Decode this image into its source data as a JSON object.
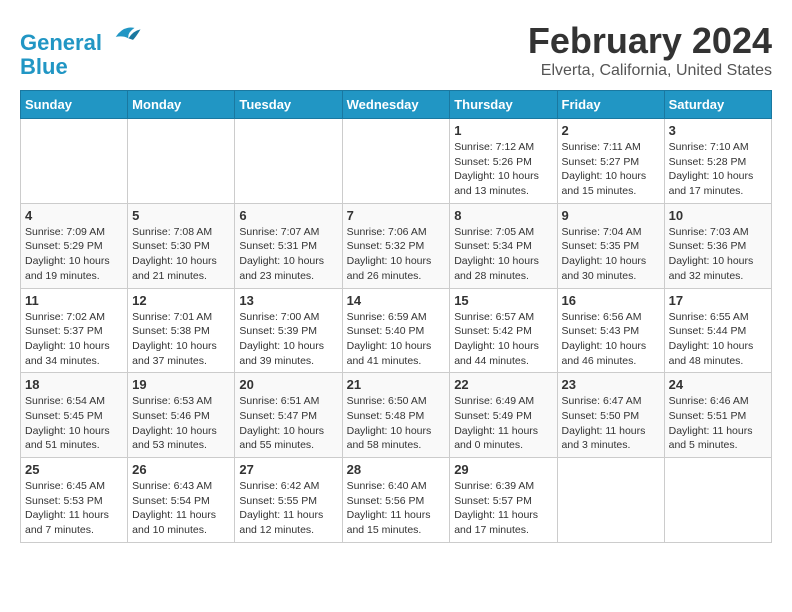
{
  "logo": {
    "line1": "General",
    "line2": "Blue"
  },
  "title": "February 2024",
  "location": "Elverta, California, United States",
  "days_header": [
    "Sunday",
    "Monday",
    "Tuesday",
    "Wednesday",
    "Thursday",
    "Friday",
    "Saturday"
  ],
  "weeks": [
    [
      {
        "day": "",
        "info": ""
      },
      {
        "day": "",
        "info": ""
      },
      {
        "day": "",
        "info": ""
      },
      {
        "day": "",
        "info": ""
      },
      {
        "day": "1",
        "info": "Sunrise: 7:12 AM\nSunset: 5:26 PM\nDaylight: 10 hours\nand 13 minutes."
      },
      {
        "day": "2",
        "info": "Sunrise: 7:11 AM\nSunset: 5:27 PM\nDaylight: 10 hours\nand 15 minutes."
      },
      {
        "day": "3",
        "info": "Sunrise: 7:10 AM\nSunset: 5:28 PM\nDaylight: 10 hours\nand 17 minutes."
      }
    ],
    [
      {
        "day": "4",
        "info": "Sunrise: 7:09 AM\nSunset: 5:29 PM\nDaylight: 10 hours\nand 19 minutes."
      },
      {
        "day": "5",
        "info": "Sunrise: 7:08 AM\nSunset: 5:30 PM\nDaylight: 10 hours\nand 21 minutes."
      },
      {
        "day": "6",
        "info": "Sunrise: 7:07 AM\nSunset: 5:31 PM\nDaylight: 10 hours\nand 23 minutes."
      },
      {
        "day": "7",
        "info": "Sunrise: 7:06 AM\nSunset: 5:32 PM\nDaylight: 10 hours\nand 26 minutes."
      },
      {
        "day": "8",
        "info": "Sunrise: 7:05 AM\nSunset: 5:34 PM\nDaylight: 10 hours\nand 28 minutes."
      },
      {
        "day": "9",
        "info": "Sunrise: 7:04 AM\nSunset: 5:35 PM\nDaylight: 10 hours\nand 30 minutes."
      },
      {
        "day": "10",
        "info": "Sunrise: 7:03 AM\nSunset: 5:36 PM\nDaylight: 10 hours\nand 32 minutes."
      }
    ],
    [
      {
        "day": "11",
        "info": "Sunrise: 7:02 AM\nSunset: 5:37 PM\nDaylight: 10 hours\nand 34 minutes."
      },
      {
        "day": "12",
        "info": "Sunrise: 7:01 AM\nSunset: 5:38 PM\nDaylight: 10 hours\nand 37 minutes."
      },
      {
        "day": "13",
        "info": "Sunrise: 7:00 AM\nSunset: 5:39 PM\nDaylight: 10 hours\nand 39 minutes."
      },
      {
        "day": "14",
        "info": "Sunrise: 6:59 AM\nSunset: 5:40 PM\nDaylight: 10 hours\nand 41 minutes."
      },
      {
        "day": "15",
        "info": "Sunrise: 6:57 AM\nSunset: 5:42 PM\nDaylight: 10 hours\nand 44 minutes."
      },
      {
        "day": "16",
        "info": "Sunrise: 6:56 AM\nSunset: 5:43 PM\nDaylight: 10 hours\nand 46 minutes."
      },
      {
        "day": "17",
        "info": "Sunrise: 6:55 AM\nSunset: 5:44 PM\nDaylight: 10 hours\nand 48 minutes."
      }
    ],
    [
      {
        "day": "18",
        "info": "Sunrise: 6:54 AM\nSunset: 5:45 PM\nDaylight: 10 hours\nand 51 minutes."
      },
      {
        "day": "19",
        "info": "Sunrise: 6:53 AM\nSunset: 5:46 PM\nDaylight: 10 hours\nand 53 minutes."
      },
      {
        "day": "20",
        "info": "Sunrise: 6:51 AM\nSunset: 5:47 PM\nDaylight: 10 hours\nand 55 minutes."
      },
      {
        "day": "21",
        "info": "Sunrise: 6:50 AM\nSunset: 5:48 PM\nDaylight: 10 hours\nand 58 minutes."
      },
      {
        "day": "22",
        "info": "Sunrise: 6:49 AM\nSunset: 5:49 PM\nDaylight: 11 hours\nand 0 minutes."
      },
      {
        "day": "23",
        "info": "Sunrise: 6:47 AM\nSunset: 5:50 PM\nDaylight: 11 hours\nand 3 minutes."
      },
      {
        "day": "24",
        "info": "Sunrise: 6:46 AM\nSunset: 5:51 PM\nDaylight: 11 hours\nand 5 minutes."
      }
    ],
    [
      {
        "day": "25",
        "info": "Sunrise: 6:45 AM\nSunset: 5:53 PM\nDaylight: 11 hours\nand 7 minutes."
      },
      {
        "day": "26",
        "info": "Sunrise: 6:43 AM\nSunset: 5:54 PM\nDaylight: 11 hours\nand 10 minutes."
      },
      {
        "day": "27",
        "info": "Sunrise: 6:42 AM\nSunset: 5:55 PM\nDaylight: 11 hours\nand 12 minutes."
      },
      {
        "day": "28",
        "info": "Sunrise: 6:40 AM\nSunset: 5:56 PM\nDaylight: 11 hours\nand 15 minutes."
      },
      {
        "day": "29",
        "info": "Sunrise: 6:39 AM\nSunset: 5:57 PM\nDaylight: 11 hours\nand 17 minutes."
      },
      {
        "day": "",
        "info": ""
      },
      {
        "day": "",
        "info": ""
      }
    ]
  ]
}
